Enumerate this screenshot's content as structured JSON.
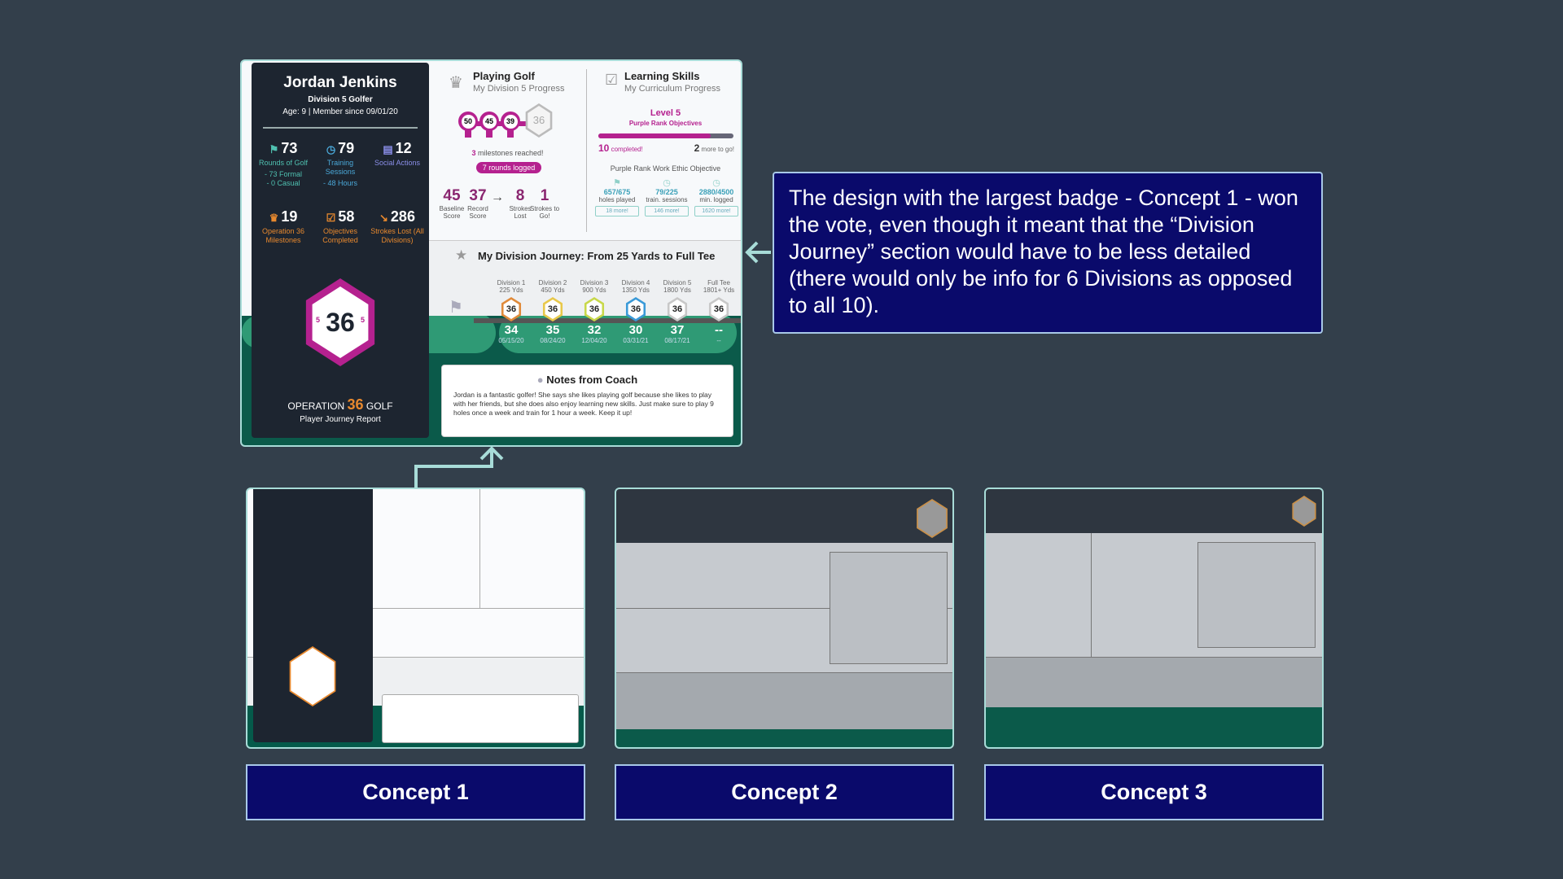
{
  "player": {
    "name": "Jordan Jenkins",
    "division": "Division 5 Golfer",
    "meta": "Age: 9 | Member since 09/01/20"
  },
  "stats": [
    {
      "icon": "flag-icon",
      "glyph": "⚑",
      "value": "73",
      "label": "Rounds of Golf",
      "extra": "- 73 Formal\n- 0 Casual",
      "color": "#4fc0b0"
    },
    {
      "icon": "stopwatch-icon",
      "glyph": "◷",
      "value": "79",
      "label": "Training Sessions",
      "extra": "- 48 Hours",
      "color": "#4aa8d8"
    },
    {
      "icon": "chat-icon",
      "glyph": "▤",
      "value": "12",
      "label": "Social Actions",
      "extra": "",
      "color": "#8a8ee8"
    },
    {
      "icon": "trophy-icon",
      "glyph": "♛",
      "value": "19",
      "label": "Operation 36 Milestones",
      "extra": "",
      "color": "#e8892e"
    },
    {
      "icon": "clipboard-icon",
      "glyph": "☑",
      "value": "58",
      "label": "Objectives Completed",
      "extra": "",
      "color": "#e8892e"
    },
    {
      "icon": "chart-down-icon",
      "glyph": "↘",
      "value": "286",
      "label": "Strokes Lost (All Divisions)",
      "extra": "",
      "color": "#e8892e"
    }
  ],
  "badge": {
    "number": "36",
    "division": "5"
  },
  "logo": {
    "left": "OPERATION",
    "mid": "36",
    "right": "GOLF",
    "subtitle": "Player Journey Report"
  },
  "playing": {
    "title": "Playing Golf",
    "subtitle": "My Division 5 Progress",
    "milestones": [
      "50",
      "45",
      "39"
    ],
    "goal": "36",
    "reached_num": "3",
    "reached_text": "milestones reached!",
    "rounds": "7 rounds logged",
    "scores": [
      {
        "v": "45",
        "l": "Baseline Score"
      },
      {
        "v": "37",
        "l": "Record Score"
      },
      {
        "v": "8",
        "l": "Strokes Lost"
      },
      {
        "v": "1",
        "l": "Strokes to Go!"
      }
    ]
  },
  "learning": {
    "title": "Learning Skills",
    "subtitle": "My Curriculum Progress",
    "level": "Level 5",
    "rank": "Purple Rank Objectives",
    "progress_completed": 10,
    "progress_total": 12,
    "completed_num": "10",
    "completed_text": "completed!",
    "togo_num": "2",
    "togo_text": "more to go!",
    "objective": "Purple Rank Work Ethic Objective",
    "items": [
      {
        "icon": "flag-icon",
        "v": "657/675",
        "l": "holes played",
        "more": "18 more!"
      },
      {
        "icon": "stopwatch-icon",
        "v": "79/225",
        "l": "train. sessions",
        "more": "146 more!"
      },
      {
        "icon": "stopwatch-icon",
        "v": "2880/4500",
        "l": "min. logged",
        "more": "1620 more!"
      }
    ]
  },
  "journey": {
    "title": "My Division Journey: From 25 Yards to Full Tee",
    "divisions": [
      {
        "name": "Division 1",
        "yds": "225 Yds",
        "score": "34",
        "date": "05/15/20",
        "color": "#e08a3a"
      },
      {
        "name": "Division 2",
        "yds": "450 Yds",
        "score": "35",
        "date": "08/24/20",
        "color": "#e8c84a"
      },
      {
        "name": "Division 3",
        "yds": "900 Yds",
        "score": "32",
        "date": "12/04/20",
        "color": "#c8d84a"
      },
      {
        "name": "Division 4",
        "yds": "1350 Yds",
        "score": "30",
        "date": "03/31/21",
        "color": "#3a9ad8"
      },
      {
        "name": "Division 5",
        "yds": "1800 Yds",
        "score": "37",
        "date": "08/17/21",
        "color": "#c8c8c8"
      },
      {
        "name": "Full Tee",
        "yds": "1801+ Yds",
        "score": "--",
        "date": "--",
        "color": "#c8c8c8"
      }
    ]
  },
  "notes": {
    "title": "Notes from Coach",
    "text": "Jordan is a fantastic golfer! She says she likes playing golf because she likes to play with her friends, but she does also enjoy learning new skills. Just make sure to play 9 holes once a week and train for 1 hour a week. Keep it up!"
  },
  "callout": "The design with the largest badge - Concept 1 - won the vote, even though it meant that the “Division Journey” section would have to be less detailed (there would only be info for 6 Divisions as opposed to all 10).",
  "concepts": [
    "Concept 1",
    "Concept 2",
    "Concept 3"
  ],
  "colors": {
    "background": "#333f4b",
    "accent_purple": "#b5218f",
    "dark_panel": "#1d2530",
    "green": "#0b5a4a",
    "label_blue": "#0a0a6b"
  }
}
